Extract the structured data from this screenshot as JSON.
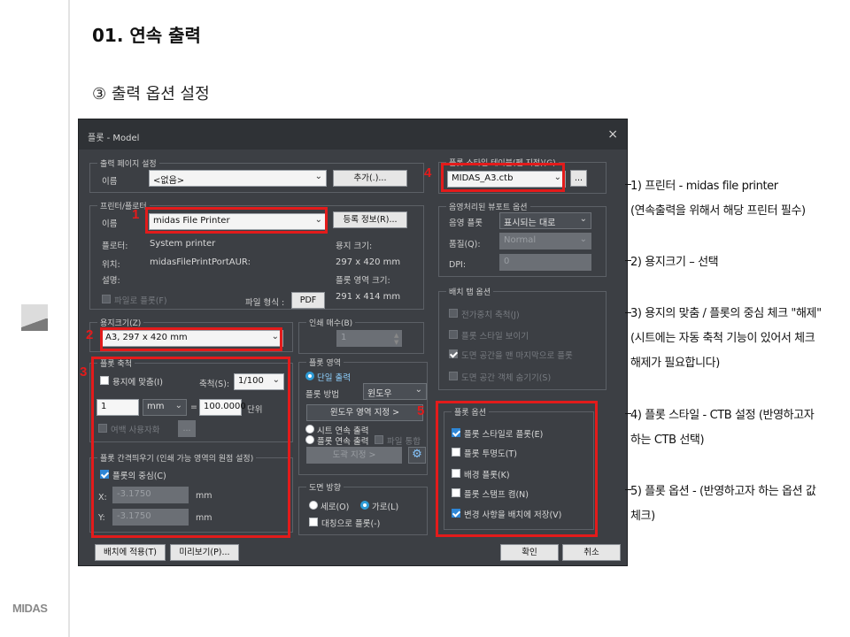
{
  "slide": {
    "title": "01. 연속 출력",
    "subtitle": "③ 출력 옵션 설정",
    "logo": "MIDAS"
  },
  "dialog": {
    "title": "플롯 - Model",
    "close": "×",
    "page_setup": {
      "group": "출력 페이지 설정",
      "name_label": "이름",
      "name_value": "<없음>",
      "add_button": "추가(.)..."
    },
    "printer": {
      "group": "프린터/플로터",
      "name_label": "이름",
      "name_value": "midas File Printer",
      "props_button": "등록 정보(R)...",
      "plotter_label": "플로터:",
      "plotter_value": "System printer",
      "where_label": "위치:",
      "where_value": "midasFilePrintPortAUR:",
      "desc_label": "설명:",
      "paper_size_label": "용지 크기:",
      "paper_size_value": "297 x 420 mm",
      "plot_area_label": "플롯 영역 크기:",
      "plot_area_value": "291 x 414 mm",
      "plot_to_file": "파일로 플롯(F)",
      "file_format_label": "파일 형식 :",
      "file_format_value": "PDF"
    },
    "paper_size": {
      "group": "용지크기(Z)",
      "value": "A3, 297 x 420 mm"
    },
    "copies": {
      "group": "인쇄 매수(B)",
      "value": "1"
    },
    "plot_scale": {
      "group": "플롯 축척",
      "fit_paper": "용지에 맞춤(I)",
      "scale_label": "축척(S):",
      "scale_value": "1/100",
      "value1": "1",
      "unit": "mm",
      "equals": "=",
      "value2": "100.0000",
      "unit_label": "단위",
      "scale_lineweights": "여백 사용자화",
      "ellipsis": "..."
    },
    "plot_offset": {
      "group": "플롯 간격띄우기 (인쇄 가능 영역의 원점 설정)",
      "center": "플롯의 중심(C)",
      "x_label": "X:",
      "x_value": "-3.1750",
      "y_label": "Y:",
      "y_value": "-3.1750",
      "unit": "mm"
    },
    "plot_area": {
      "group": "플롯 영역",
      "single": "단일 출력",
      "method_label": "플롯 방법",
      "method_value": "윈도우",
      "window_button": "윈도우 영역 지정 >",
      "sheet_continuous": "시트 연속 출력",
      "plot_continuous": "플롯 연속 출력",
      "file_merge": "파일 통합",
      "frame_button": "도곽 지정 >"
    },
    "orientation": {
      "group": "도면 방향",
      "portrait": "세로(O)",
      "landscape": "가로(L)",
      "upside_down": "대칭으로 플롯(-)"
    },
    "plot_style_table": {
      "group": "플롯 스타일 테이블(펜 지정)(G)",
      "value": "MIDAS_A3.ctb",
      "edit_button": "..."
    },
    "shaded_viewport": {
      "group": "음영처리된 뷰포트 옵션",
      "shade_label": "음영 플롯",
      "shade_value": "표시되는 대로",
      "quality_label": "품질(Q):",
      "quality_value": "Normal",
      "dpi_label": "DPI:",
      "dpi_value": "0"
    },
    "layout_options": {
      "group": "배치 탭 옵션",
      "opt1": "전가중치 축척(J)",
      "opt2": "플롯 스타일 보이기",
      "opt3": "도면 공간을 맨 마지막으로 플롯",
      "opt4": "도면 공간 객체 숨기기(S)"
    },
    "plot_options": {
      "group": "플롯 옵션",
      "opt1": "플롯 스타일로 플롯(E)",
      "opt2": "플롯 투명도(T)",
      "opt3": "배경 플롯(K)",
      "opt4": "플롯 스탬프 켬(N)",
      "opt5": "변경 사항을 배치에 저장(V)"
    },
    "footer": {
      "apply_layout": "배치에 적용(T)",
      "preview": "미리보기(P)...",
      "ok": "확인",
      "cancel": "취소"
    }
  },
  "markers": [
    "1",
    "2",
    "3",
    "4",
    "5"
  ],
  "notes": [
    "1) 프린터 - midas file printer",
    "(연속출력을 위해서 해당 프린터 필수)",
    "2) 용지크기 – 선택",
    "3) 용지의 맞춤 / 플롯의 중심 체크 \"해제\"",
    "(시트에는 자동 축척 기능이 있어서 체크",
    "해제가 필요합니다)",
    "4) 플롯 스타일 - CTB 설정 (반영하고자",
    "하는 CTB 선택)",
    "5) 플롯 옵션 - (반영하고자 하는 옵션 값",
    "체크)"
  ],
  "colors": {
    "dialog_bg": "#3c3f44",
    "highlight": "#e31b1b",
    "checkbox_on": "#2e86d6"
  }
}
